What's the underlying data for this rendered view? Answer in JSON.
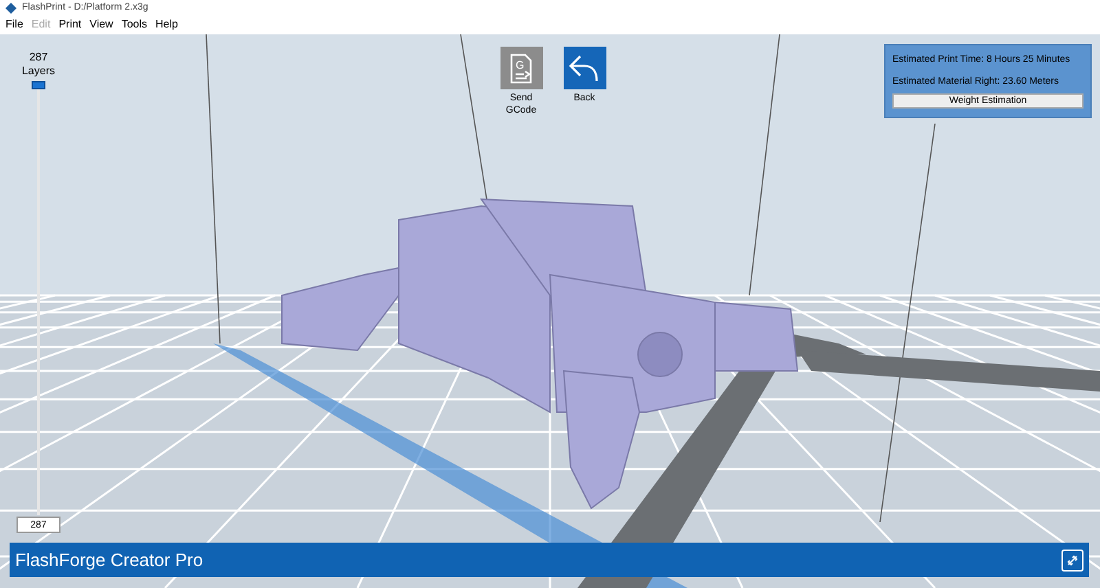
{
  "window": {
    "title": "FlashPrint - D:/Platform 2.x3g"
  },
  "menu": [
    {
      "label": "File",
      "disabled": false
    },
    {
      "label": "Edit",
      "disabled": true
    },
    {
      "label": "Print",
      "disabled": false
    },
    {
      "label": "View",
      "disabled": false
    },
    {
      "label": "Tools",
      "disabled": false
    },
    {
      "label": "Help",
      "disabled": false
    }
  ],
  "layer_slider": {
    "count": "287",
    "unit": "Layers",
    "level": 1,
    "value": "287"
  },
  "toolbar": [
    {
      "kind": "send",
      "label": "Send\nGCode",
      "icon_letter": "G"
    },
    {
      "kind": "back",
      "label": "Back"
    }
  ],
  "estimate": {
    "time": "Estimated Print Time: 8 Hours 25 Minutes",
    "material": "Estimated Material Right: 23.60 Meters",
    "button": "Weight Estimation"
  },
  "status_bar": {
    "printer": "FlashForge Creator Pro"
  }
}
